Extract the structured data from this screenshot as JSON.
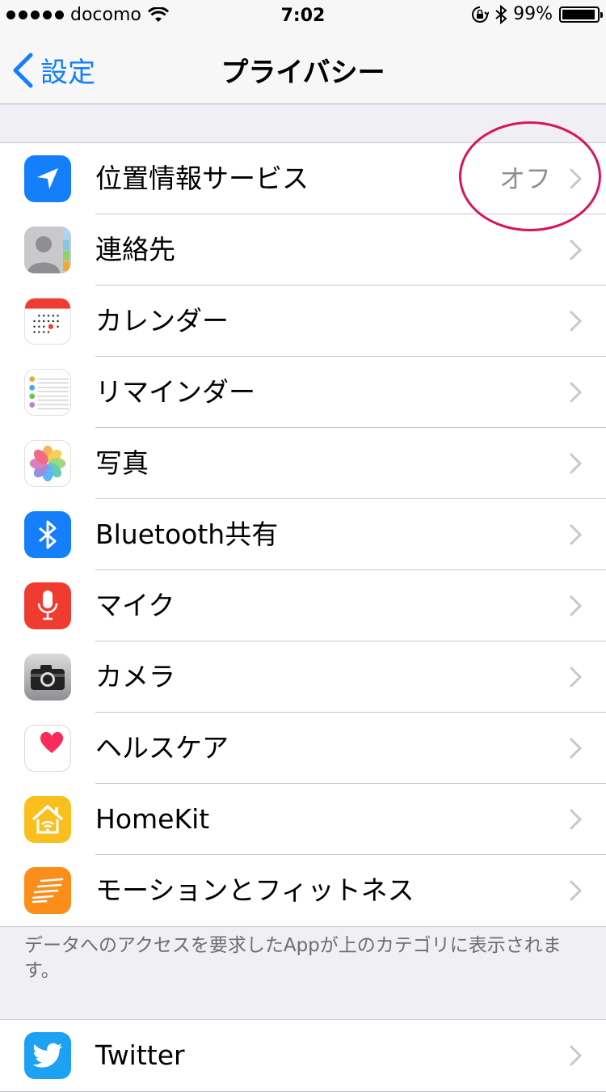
{
  "status_bar": {
    "carrier": "docomo",
    "time": "7:02",
    "battery": "99%",
    "battery_level": 0.99
  },
  "nav": {
    "back_label": "設定",
    "title": "プライバシー"
  },
  "privacy_items": [
    {
      "label": "位置情報サービス",
      "value": "オフ",
      "icon": "location-arrow-icon"
    },
    {
      "label": "連絡先",
      "value": "",
      "icon": "contacts-icon"
    },
    {
      "label": "カレンダー",
      "value": "",
      "icon": "calendar-icon"
    },
    {
      "label": "リマインダー",
      "value": "",
      "icon": "reminders-icon"
    },
    {
      "label": "写真",
      "value": "",
      "icon": "photos-icon"
    },
    {
      "label": "Bluetooth共有",
      "value": "",
      "icon": "bluetooth-icon"
    },
    {
      "label": "マイク",
      "value": "",
      "icon": "microphone-icon"
    },
    {
      "label": "カメラ",
      "value": "",
      "icon": "camera-icon"
    },
    {
      "label": "ヘルスケア",
      "value": "",
      "icon": "health-icon"
    },
    {
      "label": "HomeKit",
      "value": "",
      "icon": "homekit-icon"
    },
    {
      "label": "モーションとフィットネス",
      "value": "",
      "icon": "motion-icon"
    }
  ],
  "footer_note": "データへのアクセスを要求したAppが上のカテゴリに表示されます。",
  "social_items": [
    {
      "label": "Twitter",
      "icon": "twitter-icon"
    }
  ],
  "colors": {
    "accent": "#147efb",
    "highlight_circle": "#d7145f",
    "secondary_text": "#8e8e93"
  }
}
